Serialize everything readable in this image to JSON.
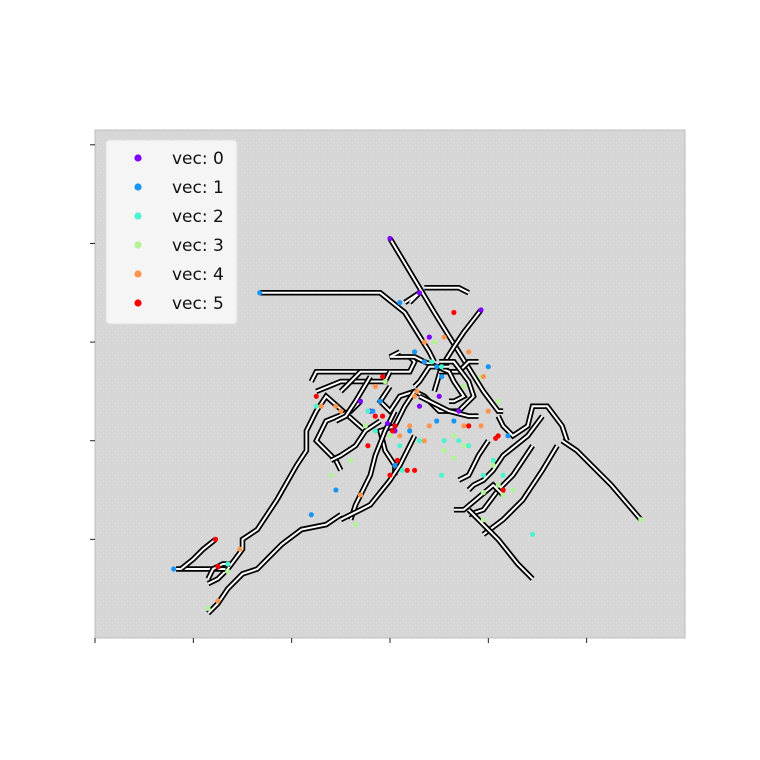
{
  "chart_data": {
    "type": "scatter",
    "title": "",
    "xlabel": "",
    "ylabel": "",
    "xlim": [
      0,
      12
    ],
    "ylim": [
      0,
      10.3
    ],
    "grid": false,
    "x_tick_values": [
      0,
      2,
      4,
      6,
      8,
      10
    ],
    "y_tick_values": [
      2,
      4,
      6,
      8,
      10
    ],
    "legend": {
      "placement": "top-left",
      "entries": [
        {
          "label": "vec:  0",
          "color": "#8000ff"
        },
        {
          "label": "vec:  1",
          "color": "#1996f3"
        },
        {
          "label": "vec:  2",
          "color": "#4df3ce"
        },
        {
          "label": "vec:  3",
          "color": "#b2f396"
        },
        {
          "label": "vec:  4",
          "color": "#ff964f"
        },
        {
          "label": "vec:  5",
          "color": "#ff0000"
        }
      ]
    },
    "paths": [
      [
        [
          6.0,
          8.1
        ],
        [
          6.9,
          6.6
        ],
        [
          7.9,
          5.0
        ],
        [
          8.2,
          4.6
        ],
        [
          8.3,
          4.6
        ]
      ],
      [
        [
          6.3,
          6.8
        ],
        [
          6.6,
          7.0
        ],
        [
          6.4,
          6.8
        ]
      ],
      [
        [
          3.35,
          7.0
        ],
        [
          5.8,
          7.0
        ],
        [
          6.3,
          6.6
        ],
        [
          6.8,
          5.8
        ],
        [
          6.9,
          5.6
        ]
      ],
      [
        [
          6.7,
          7.1
        ],
        [
          7.4,
          7.1
        ],
        [
          7.6,
          7.0
        ]
      ],
      [
        [
          7.85,
          6.65
        ],
        [
          7.5,
          6.2
        ],
        [
          7.3,
          5.9
        ],
        [
          7.05,
          5.5
        ],
        [
          6.9,
          5.0
        ]
      ],
      [
        [
          4.4,
          5.2
        ],
        [
          4.5,
          5.4
        ],
        [
          5.0,
          5.4
        ],
        [
          6.0,
          5.4
        ],
        [
          6.4,
          5.4
        ],
        [
          6.5,
          5.6
        ],
        [
          6.4,
          5.7
        ]
      ],
      [
        [
          4.5,
          5.0
        ],
        [
          5.0,
          5.2
        ],
        [
          5.9,
          5.2
        ],
        [
          6.0,
          5.4
        ]
      ],
      [
        [
          7.0,
          5.4
        ],
        [
          7.4,
          5.4
        ],
        [
          7.6,
          5.6
        ],
        [
          7.8,
          5.6
        ]
      ],
      [
        [
          7.0,
          5.6
        ],
        [
          7.3,
          5.6
        ],
        [
          7.6,
          5.2
        ],
        [
          7.7,
          4.9
        ],
        [
          7.4,
          4.6
        ],
        [
          7.0,
          4.6
        ],
        [
          6.7,
          4.9
        ],
        [
          6.5,
          5.0
        ],
        [
          6.2,
          4.9
        ],
        [
          6.0,
          4.6
        ],
        [
          5.8,
          4.8
        ],
        [
          6.0,
          5.1
        ]
      ],
      [
        [
          6.2,
          5.8
        ],
        [
          6.0,
          5.7
        ],
        [
          6.5,
          5.7
        ],
        [
          6.7,
          5.6
        ],
        [
          7.2,
          5.4
        ],
        [
          7.3,
          5.2
        ],
        [
          7.5,
          4.9
        ],
        [
          7.3,
          4.8
        ],
        [
          7.2,
          4.8
        ]
      ],
      [
        [
          6.5,
          5.0
        ],
        [
          6.3,
          4.7
        ],
        [
          6.1,
          4.3
        ],
        [
          5.8,
          4.2
        ],
        [
          5.9,
          3.8
        ],
        [
          6.1,
          3.5
        ],
        [
          6.1,
          3.3
        ]
      ],
      [
        [
          5.5,
          4.2
        ],
        [
          4.7,
          4.9
        ],
        [
          4.5,
          4.6
        ],
        [
          4.3,
          4.2
        ],
        [
          4.3,
          3.8
        ],
        [
          4.1,
          3.5
        ],
        [
          3.7,
          2.8
        ],
        [
          3.5,
          2.5
        ],
        [
          3.3,
          2.2
        ],
        [
          3.0,
          2.0
        ],
        [
          3.0,
          1.8
        ],
        [
          2.7,
          1.4
        ],
        [
          2.5,
          1.2
        ],
        [
          2.3,
          1.1
        ]
      ],
      [
        [
          5.4,
          4.8
        ],
        [
          5.2,
          4.6
        ],
        [
          4.7,
          4.4
        ],
        [
          4.5,
          4.0
        ],
        [
          4.9,
          3.6
        ],
        [
          5.0,
          3.4
        ]
      ],
      [
        [
          5.8,
          4.4
        ],
        [
          5.5,
          4.2
        ],
        [
          5.3,
          3.9
        ],
        [
          5.0,
          3.7
        ],
        [
          4.8,
          3.6
        ]
      ],
      [
        [
          6.1,
          4.6
        ],
        [
          5.9,
          4.2
        ],
        [
          5.7,
          3.7
        ],
        [
          5.6,
          3.3
        ],
        [
          5.4,
          2.9
        ],
        [
          5.3,
          2.7
        ],
        [
          5.2,
          2.4
        ]
      ],
      [
        [
          6.5,
          4.1
        ],
        [
          6.2,
          3.5
        ],
        [
          6.0,
          3.2
        ],
        [
          5.6,
          2.7
        ],
        [
          5.4,
          2.6
        ],
        [
          5.2,
          2.5
        ],
        [
          5.0,
          2.4
        ]
      ],
      [
        [
          8.2,
          4.5
        ],
        [
          8.3,
          4.3
        ],
        [
          8.5,
          4.1
        ],
        [
          8.8,
          4.3
        ],
        [
          8.9,
          4.7
        ],
        [
          9.2,
          4.7
        ],
        [
          9.5,
          4.3
        ],
        [
          9.6,
          4.0
        ]
      ],
      [
        [
          9.1,
          4.5
        ],
        [
          8.8,
          4.1
        ],
        [
          8.3,
          3.7
        ],
        [
          8.1,
          3.4
        ],
        [
          7.9,
          3.2
        ],
        [
          7.7,
          3.1
        ],
        [
          7.6,
          3.0
        ]
      ],
      [
        [
          8.0,
          4.0
        ],
        [
          7.8,
          3.7
        ],
        [
          7.6,
          3.3
        ],
        [
          7.4,
          3.2
        ]
      ],
      [
        [
          8.9,
          3.9
        ],
        [
          8.5,
          3.3
        ],
        [
          8.2,
          3.0
        ],
        [
          7.9,
          2.6
        ],
        [
          7.6,
          2.5
        ]
      ],
      [
        [
          9.4,
          3.9
        ],
        [
          9.1,
          3.4
        ],
        [
          8.7,
          2.8
        ],
        [
          8.3,
          2.4
        ],
        [
          7.9,
          2.1
        ]
      ],
      [
        [
          8.3,
          2.9
        ],
        [
          8.1,
          3.1
        ],
        [
          7.5,
          2.6
        ],
        [
          7.3,
          2.6
        ]
      ],
      [
        [
          9.5,
          4.0
        ],
        [
          9.8,
          3.8
        ],
        [
          10.5,
          3.1
        ],
        [
          11.1,
          2.4
        ]
      ],
      [
        [
          7.6,
          2.6
        ],
        [
          8.2,
          2.0
        ],
        [
          8.6,
          1.5
        ],
        [
          8.9,
          1.2
        ]
      ],
      [
        [
          5.0,
          2.5
        ],
        [
          4.7,
          2.3
        ],
        [
          4.2,
          2.2
        ],
        [
          3.8,
          1.9
        ],
        [
          3.5,
          1.6
        ],
        [
          3.3,
          1.4
        ],
        [
          3.0,
          1.3
        ],
        [
          2.7,
          1.0
        ],
        [
          2.5,
          0.7
        ],
        [
          2.4,
          0.6
        ],
        [
          2.3,
          0.5
        ]
      ],
      [
        [
          1.65,
          1.4
        ],
        [
          2.3,
          1.4
        ],
        [
          2.65,
          1.4
        ]
      ],
      [
        [
          1.75,
          1.4
        ],
        [
          2.0,
          1.6
        ],
        [
          2.2,
          1.8
        ],
        [
          2.45,
          2.0
        ]
      ],
      [
        [
          2.3,
          1.2
        ],
        [
          2.4,
          1.4
        ],
        [
          2.6,
          1.5
        ],
        [
          2.75,
          1.5
        ]
      ],
      [
        [
          7.2,
          5.5
        ],
        [
          6.8,
          5.5
        ],
        [
          6.6,
          5.2
        ],
        [
          6.5,
          5.1
        ]
      ],
      [
        [
          5.9,
          5.4
        ],
        [
          5.4,
          5.4
        ],
        [
          5.1,
          5.1
        ],
        [
          5.0,
          5.0
        ]
      ],
      [
        [
          5.6,
          5.3
        ],
        [
          5.3,
          4.8
        ],
        [
          5.1,
          4.5
        ],
        [
          4.9,
          4.4
        ]
      ],
      [
        [
          6.6,
          4.9
        ],
        [
          7.2,
          4.6
        ],
        [
          7.6,
          4.5
        ],
        [
          7.8,
          4.5
        ]
      ]
    ],
    "series": [
      {
        "name": "vec:  0",
        "color": "#8000ff",
        "points": [
          [
            6.0,
            8.1
          ],
          [
            6.6,
            7.0
          ],
          [
            7.85,
            6.65
          ],
          [
            6.8,
            6.1
          ],
          [
            5.4,
            4.8
          ],
          [
            5.6,
            4.6
          ],
          [
            6.1,
            4.2
          ],
          [
            5.95,
            4.35
          ],
          [
            7.0,
            4.9
          ],
          [
            6.6,
            4.7
          ],
          [
            7.4,
            4.6
          ]
        ]
      },
      {
        "name": "vec:  1",
        "color": "#1996f3",
        "points": [
          [
            6.2,
            6.8
          ],
          [
            3.35,
            7.0
          ],
          [
            6.5,
            5.8
          ],
          [
            6.7,
            5.6
          ],
          [
            6.95,
            5.5
          ],
          [
            7.05,
            5.3
          ],
          [
            8.0,
            5.5
          ],
          [
            5.8,
            4.8
          ],
          [
            5.65,
            4.6
          ],
          [
            7.3,
            4.4
          ],
          [
            6.95,
            4.4
          ],
          [
            8.4,
            4.1
          ],
          [
            4.9,
            3.0
          ],
          [
            4.4,
            2.5
          ],
          [
            1.6,
            1.4
          ],
          [
            6.1,
            3.5
          ],
          [
            6.4,
            4.2
          ]
        ]
      },
      {
        "name": "vec:  2",
        "color": "#4df3ce",
        "points": [
          [
            6.85,
            5.6
          ],
          [
            7.05,
            5.5
          ],
          [
            7.9,
            5.3
          ],
          [
            4.5,
            4.7
          ],
          [
            5.55,
            4.6
          ],
          [
            5.7,
            4.2
          ],
          [
            6.6,
            4.0
          ],
          [
            7.1,
            4.0
          ],
          [
            7.4,
            4.0
          ],
          [
            7.6,
            3.9
          ],
          [
            7.05,
            3.3
          ],
          [
            6.2,
            3.9
          ],
          [
            6.25,
            3.4
          ],
          [
            8.1,
            3.6
          ],
          [
            7.9,
            3.3
          ],
          [
            8.3,
            3.3
          ],
          [
            8.9,
            2.1
          ],
          [
            2.7,
            1.5
          ]
        ]
      },
      {
        "name": "vec:  3",
        "color": "#b2f396",
        "points": [
          [
            6.9,
            6.0
          ],
          [
            7.85,
            5.3
          ],
          [
            5.9,
            5.2
          ],
          [
            7.5,
            5.1
          ],
          [
            8.2,
            4.8
          ],
          [
            7.3,
            4.1
          ],
          [
            7.5,
            3.9
          ],
          [
            7.3,
            3.65
          ],
          [
            5.5,
            4.3
          ],
          [
            6.0,
            4.1
          ],
          [
            7.1,
            3.8
          ],
          [
            8.1,
            3.5
          ],
          [
            8.2,
            3.1
          ],
          [
            7.9,
            2.95
          ],
          [
            8.5,
            3.0
          ],
          [
            8.3,
            2.9
          ],
          [
            7.9,
            2.4
          ],
          [
            5.3,
            2.3
          ],
          [
            11.1,
            2.4
          ],
          [
            4.8,
            3.3
          ],
          [
            2.3,
            0.6
          ],
          [
            2.7,
            1.35
          ],
          [
            5.2,
            3.6
          ]
        ]
      },
      {
        "name": "vec:  4",
        "color": "#ff964f",
        "points": [
          [
            6.7,
            6.0
          ],
          [
            7.1,
            6.1
          ],
          [
            7.6,
            5.8
          ],
          [
            7.9,
            5.3
          ],
          [
            4.6,
            4.7
          ],
          [
            4.9,
            4.7
          ],
          [
            5.0,
            4.6
          ],
          [
            5.7,
            5.1
          ],
          [
            6.55,
            5.0
          ],
          [
            6.5,
            4.9
          ],
          [
            6.7,
            4.0
          ],
          [
            6.2,
            4.1
          ],
          [
            6.4,
            4.3
          ],
          [
            6.8,
            4.3
          ],
          [
            7.5,
            4.3
          ],
          [
            7.85,
            4.3
          ],
          [
            5.4,
            2.9
          ],
          [
            2.95,
            1.8
          ],
          [
            2.5,
            0.75
          ],
          [
            8.0,
            4.6
          ]
        ]
      },
      {
        "name": "vec:  5",
        "color": "#ff0000",
        "points": [
          [
            7.3,
            6.6
          ],
          [
            5.85,
            5.3
          ],
          [
            4.5,
            4.9
          ],
          [
            5.7,
            4.5
          ],
          [
            5.85,
            4.5
          ],
          [
            6.05,
            4.2
          ],
          [
            6.1,
            4.3
          ],
          [
            7.6,
            4.3
          ],
          [
            8.2,
            4.1
          ],
          [
            6.15,
            3.6
          ],
          [
            6.0,
            3.3
          ],
          [
            6.35,
            3.4
          ],
          [
            6.5,
            3.4
          ],
          [
            8.3,
            3.0
          ],
          [
            5.55,
            3.9
          ],
          [
            2.45,
            2.0
          ],
          [
            2.5,
            1.45
          ],
          [
            8.15,
            4.05
          ]
        ]
      }
    ]
  }
}
